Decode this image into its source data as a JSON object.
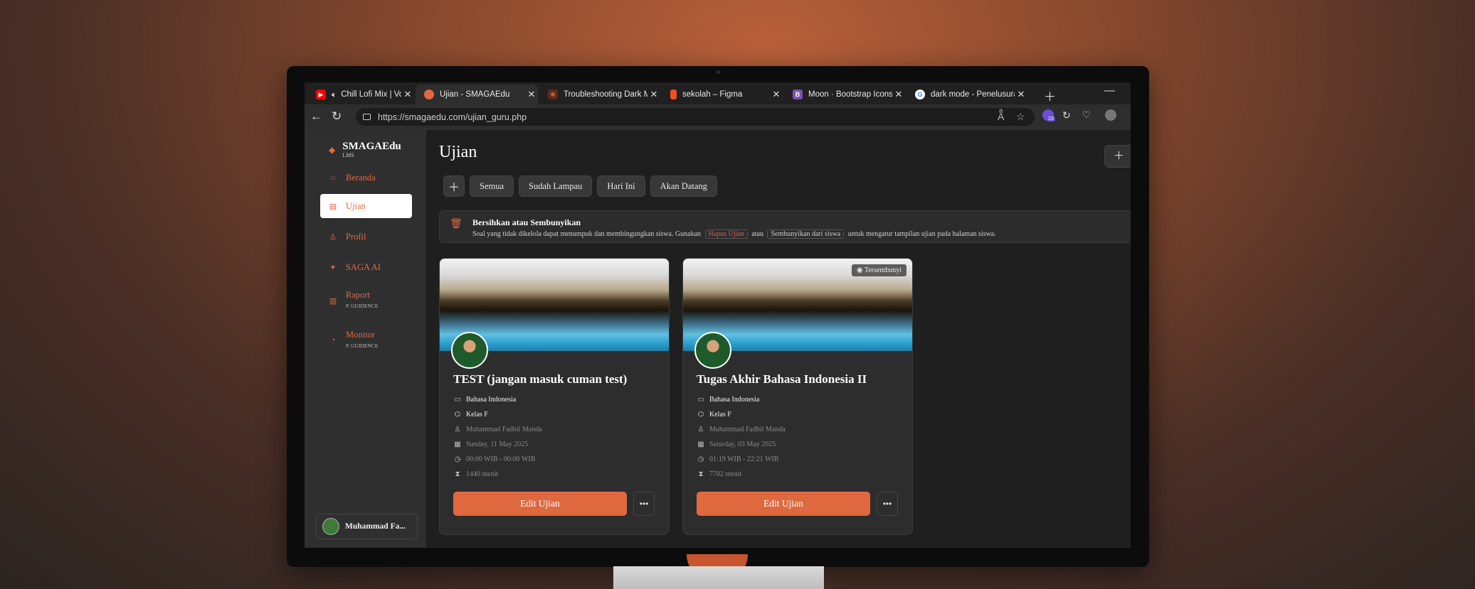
{
  "browser": {
    "tabs": [
      {
        "title": "Chill Lofi Mix | Vol.",
        "favicon": "youtube-icon",
        "color": "#ff0000"
      },
      {
        "title": "Ujian - SMAGAEdu",
        "favicon": "smagaedu-icon",
        "color": "#e0683f"
      },
      {
        "title": "Troubleshooting Dark M",
        "favicon": "claude-icon",
        "color": "#d9603b"
      },
      {
        "title": "sekolah – Figma",
        "favicon": "figma-icon",
        "color": "#a259ff"
      },
      {
        "title": "Moon · Bootstrap Icons",
        "favicon": "bootstrap-icon",
        "color": "#7952b3"
      },
      {
        "title": "dark mode - Penelusuran",
        "favicon": "google-icon",
        "color": "#4285f4"
      }
    ],
    "active_tab_index": 1,
    "url": "https://smagaedu.com/ujian_guru.php",
    "extension_badge": "23"
  },
  "sidebar": {
    "brand": "SMAGAEdu",
    "brand_sub": "LMS",
    "items": [
      {
        "label": "Beranda",
        "sub": "",
        "icon": "home-icon"
      },
      {
        "label": "Ujian",
        "sub": "",
        "icon": "document-icon"
      },
      {
        "label": "Profil",
        "sub": "",
        "icon": "person-icon"
      },
      {
        "label": "SAGA AI",
        "sub": "",
        "icon": "sparkle-icon"
      },
      {
        "label": "Raport",
        "sub": "P. GUIDENCE",
        "icon": "report-icon"
      },
      {
        "label": "Monitor",
        "sub": "P. GUIDENCE",
        "icon": "monitor-icon"
      }
    ],
    "active_item": "Ujian",
    "user": "Muhammad Fa..."
  },
  "main": {
    "title": "Ujian",
    "filters": [
      "Semua",
      "Sudah Lampau",
      "Hari Ini",
      "Akan Datang"
    ],
    "banner": {
      "title": "Bersihkan atau Sembunyikan",
      "text_1": "Soal yang tidak dikelola dapat menumpuk dan membingungkan siswa. Gunakan",
      "tag_delete": "Hapus Ujian",
      "text_2": "atau",
      "tag_hide": "Sembunyikan dari siswa",
      "text_3": "untuk mengatur tampilan ujian pada halaman siswa."
    },
    "cards": [
      {
        "title": "TEST (jangan masuk cuman test)",
        "subject": "Bahasa Indonesia",
        "class": "Kelas F",
        "teacher": "Muhammad Fadhil Manda",
        "date": "Sunday, 11 May 2025",
        "time": "00:00 WIB - 00:00 WIB",
        "duration": "1440 menit",
        "hidden_badge": "",
        "edit_label": "Edit Ujian"
      },
      {
        "title": "Tugas Akhir Bahasa Indonesia II",
        "subject": "Bahasa Indonesia",
        "class": "Kelas F",
        "teacher": "Muhammad Fadhil Manda",
        "date": "Saturday, 03 May 2025",
        "time": "01:19 WIB - 22:21 WIB",
        "duration": "7702 menit",
        "hidden_badge": "Tersembunyi",
        "edit_label": "Edit Ujian"
      }
    ]
  },
  "colors": {
    "accent": "#e0683f",
    "surface": "#2f2f2f",
    "background": "#1f1f1f"
  }
}
